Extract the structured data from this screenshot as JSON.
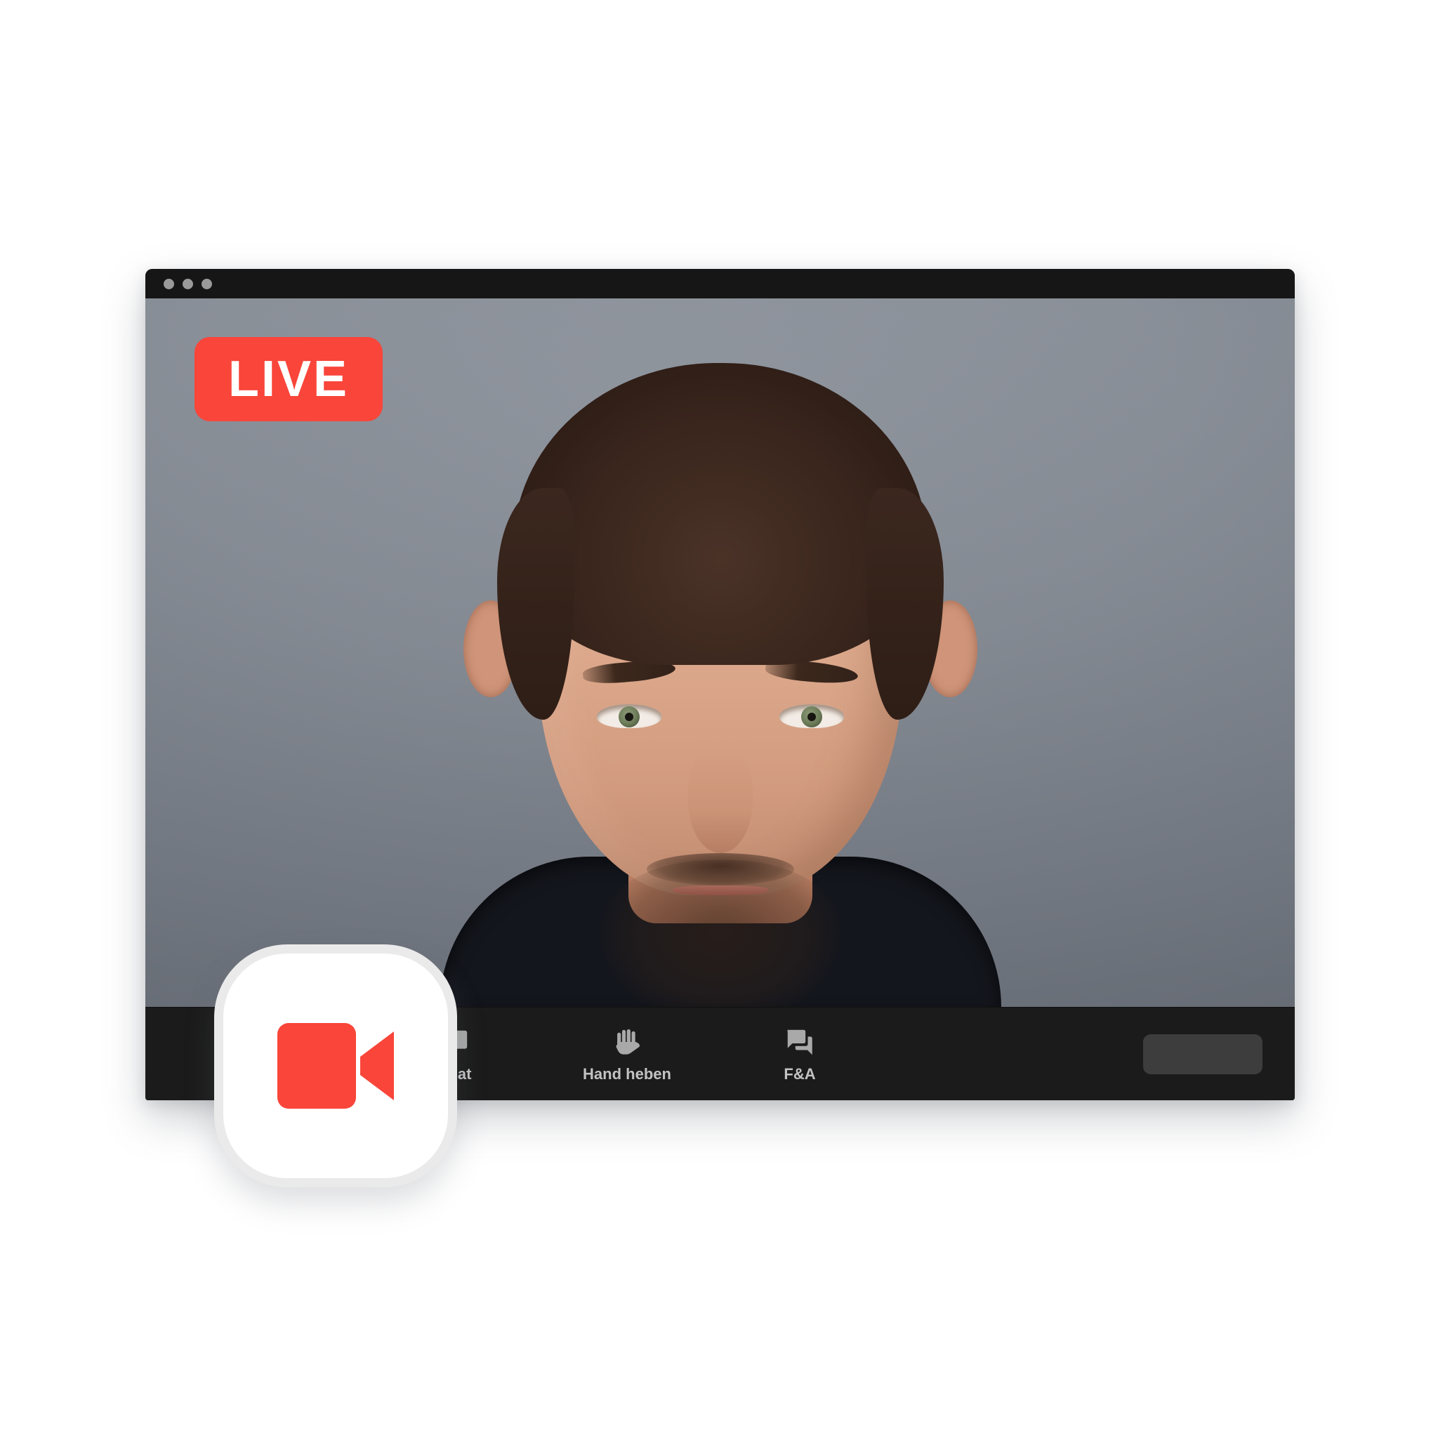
{
  "window": {
    "titlebar": {
      "dots": [
        {
          "name": "close",
          "color": "#9a9a9a"
        },
        {
          "name": "minimize",
          "color": "#9a9a9a"
        },
        {
          "name": "zoom",
          "color": "#9a9a9a"
        }
      ]
    }
  },
  "video": {
    "live_badge": {
      "label": "LIVE",
      "background": "#f9453a",
      "text_color": "#ffffff"
    },
    "backdrop_color": "#7e848d",
    "subject": "presenter-portrait"
  },
  "toolbar": {
    "background": "#1b1b1b",
    "items": [
      {
        "icon": "chat-bubble-icon",
        "label": "Chat"
      },
      {
        "icon": "raised-hand-icon",
        "label": "Hand heben"
      },
      {
        "icon": "forum-bubbles-icon",
        "label": "F&A"
      }
    ],
    "action_button": {
      "label": "",
      "background": "#3d3d3d"
    }
  },
  "camera_badge": {
    "icon": "video-camera-icon",
    "icon_color": "#f9453a",
    "background": "#ffffff",
    "ring_color": "#eaeaea"
  }
}
